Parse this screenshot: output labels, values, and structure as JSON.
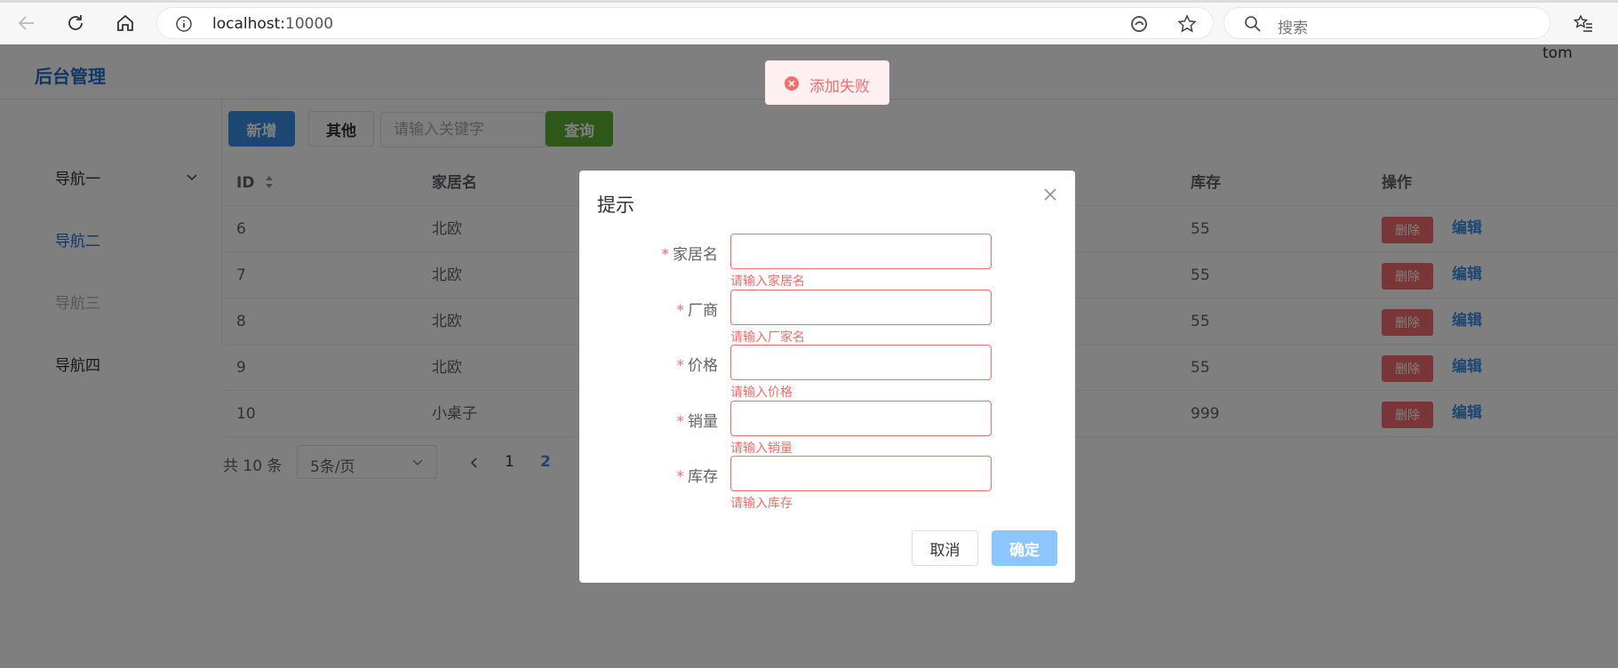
{
  "browser": {
    "url_host": "localhost:",
    "url_port": "10000",
    "search_placeholder": "搜索"
  },
  "app": {
    "brand": "后台管理",
    "user": "tom"
  },
  "sidebar": {
    "items": [
      {
        "label": "导航一"
      },
      {
        "label": "导航二"
      },
      {
        "label": "导航三"
      },
      {
        "label": "导航四"
      }
    ]
  },
  "toolbar": {
    "add_label": "新增",
    "other_label": "其他",
    "keyword_placeholder": "请输入关键字",
    "query_label": "查询"
  },
  "table": {
    "headers": {
      "id": "ID",
      "name": "家居名",
      "stock": "库存",
      "ops": "操作"
    },
    "rows": [
      {
        "id": "6",
        "name": "北欧",
        "stock": "55"
      },
      {
        "id": "7",
        "name": "北欧",
        "stock": "55"
      },
      {
        "id": "8",
        "name": "北欧",
        "stock": "55"
      },
      {
        "id": "9",
        "name": "北欧",
        "stock": "55"
      },
      {
        "id": "10",
        "name": "小桌子",
        "stock": "999"
      }
    ],
    "delete_label": "删除",
    "edit_label": "编辑"
  },
  "pager": {
    "total": "共 10 条",
    "page_size": "5条/页",
    "pages": [
      "1",
      "2"
    ],
    "current_page": "2"
  },
  "toast": {
    "message": "添加失败"
  },
  "dialog": {
    "title": "提示",
    "fields": [
      {
        "label": "家居名",
        "value": "",
        "error": "请输入家居名"
      },
      {
        "label": "厂商",
        "value": "",
        "error": "请输入厂家名"
      },
      {
        "label": "价格",
        "value": "",
        "error": "请输入价格"
      },
      {
        "label": "销量",
        "value": "",
        "error": "请输入销量"
      },
      {
        "label": "库存",
        "value": "",
        "error": "请输入库存"
      }
    ],
    "cancel_label": "取消",
    "ok_label": "确定"
  },
  "colors": {
    "primary": "#3a8ee6",
    "danger": "#f56c6c",
    "success": "#5daf34"
  }
}
